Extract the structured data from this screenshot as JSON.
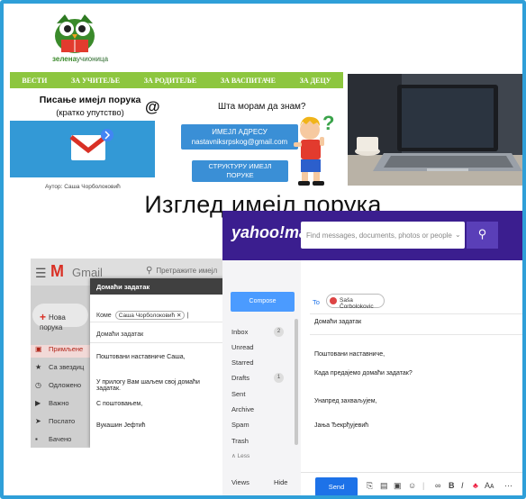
{
  "site": {
    "logo_text_bold": "зелена",
    "logo_text_rest": "учионица",
    "nav": [
      "ВЕСТИ",
      "ЗА УЧИТЕЉЕ",
      "ЗА РОДИТЕЉЕ",
      "ЗА ВАСПИТАЧЕ",
      "ЗА ДЕЦУ"
    ],
    "title_line1": "Писање имејл порука",
    "title_line2": "(кратко упутство)",
    "at_sign": "@",
    "question": "Шта морам да знам?",
    "button_a_line1": "ИМЕЈЛ АДРЕСУ",
    "button_a_line2": "nastavniksrpskog@gmail.com",
    "button_b_line1": "СТРУКТУРУ ИМЕЈЛ",
    "button_b_line2": "ПОРУКЕ",
    "author": "Аутор: Саша Чорболоковић",
    "main_heading": "Изглед имејл порука",
    "accent_green": "#8dc63f",
    "accent_blue": "#3a8fd6"
  },
  "gmail": {
    "logo_m": "M",
    "logo_word": "Gmail",
    "search_placeholder": "Претражите имејл",
    "new_message": "Нова порука",
    "sidebar": [
      "Примљене",
      "Са звездиц",
      "Одложено",
      "Важно",
      "Послато",
      "Бачено"
    ],
    "compose": {
      "header": "Домаћи задатак",
      "to_label": "Коме",
      "to_chip": "Саша Чорболоковић",
      "subject": "Домаћи задатак",
      "body": [
        "Поштовани наставниче Саша,",
        "У прилогу Вам шаљем свој домаћи задатак.",
        "С поштовањем,",
        "Вукашин Јефтић"
      ]
    }
  },
  "yahoo": {
    "logo": "yahoo!mail",
    "search_placeholder": "Find messages, documents, photos or people",
    "compose_button": "Compose",
    "folders": [
      "Inbox",
      "Unread",
      "Starred",
      "Drafts",
      "Sent",
      "Archive",
      "Spam",
      "Trash",
      "∧ Less"
    ],
    "inbox_count": "2",
    "drafts_count": "1",
    "views_label": "Views",
    "hide_label": "Hide",
    "to_label": "To",
    "to_chip": "Saša Čorbolokovic",
    "subject": "Домаћи задатак",
    "body": [
      "Поштовани наставниче,",
      "Када предајемо домаћи задатак?",
      "Унапред захваљујем,",
      "Јања Ђекрђујевић"
    ],
    "send_button": "Send",
    "accent_purple": "#3b1e8f"
  }
}
